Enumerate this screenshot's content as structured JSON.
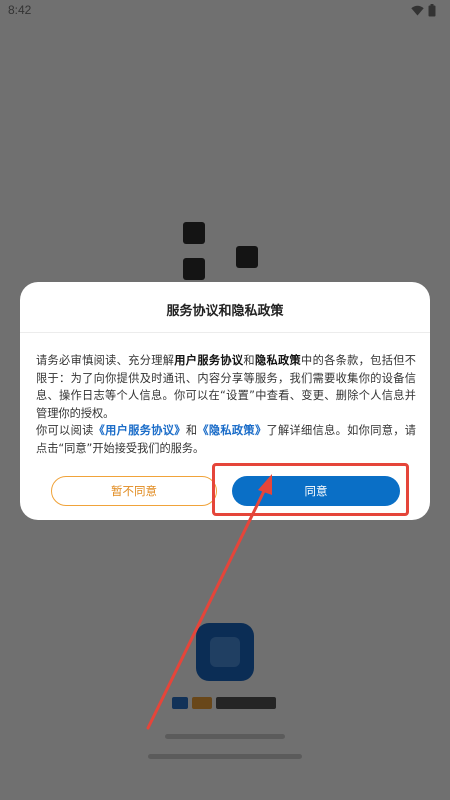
{
  "status_bar": {
    "time": "8:42",
    "icons": [
      "wifi-icon",
      "battery-icon"
    ]
  },
  "dialog": {
    "title": "服务协议和隐私政策",
    "para1": {
      "t1": "请务必审慎阅读、充分理解",
      "b1": "用户服务协议",
      "t2": "和",
      "b2": "隐私政策",
      "t3": "中的各条款，包括但不限于：为了向你提供及时通讯、内容分享等服务，我们需要收集你的设备信息、操作日志等个人信息。你可以在“设置”中查看、变更、删除个人信息并管理你的授权。"
    },
    "para2": {
      "t1": "你可以阅读",
      "l1": "《用户服务协议》",
      "t2": "和",
      "l2": "《隐私政策》",
      "t3": "了解详细信息。如你同意，请点击“同意”开始接受我们的服务。"
    },
    "disagree_label": "暂不同意",
    "agree_label": "同意"
  },
  "colors": {
    "accent_blue": "#0a6fc6",
    "link_blue": "#1a6cc8",
    "disagree_orange": "#f0a33a",
    "annotation_red": "#e5453a"
  }
}
